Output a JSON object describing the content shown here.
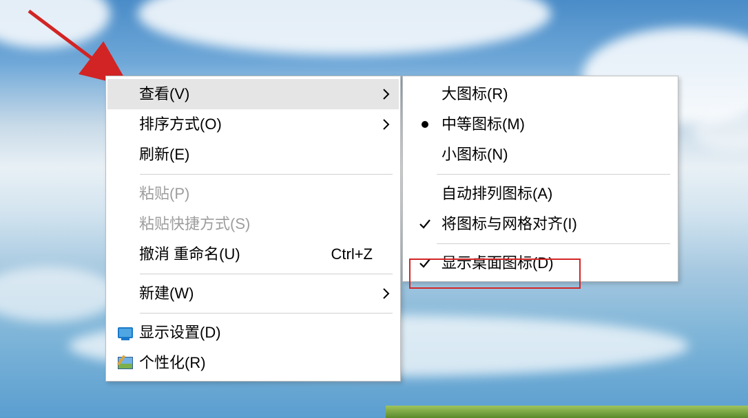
{
  "main_menu": {
    "view": "查看(V)",
    "sort": "排序方式(O)",
    "refresh": "刷新(E)",
    "paste": "粘贴(P)",
    "paste_shortcut": "粘贴快捷方式(S)",
    "undo_rename": "撤消 重命名(U)",
    "undo_accel": "Ctrl+Z",
    "new": "新建(W)",
    "display_settings": "显示设置(D)",
    "personalize": "个性化(R)"
  },
  "sub_menu": {
    "large_icons": "大图标(R)",
    "medium_icons": "中等图标(M)",
    "small_icons": "小图标(N)",
    "auto_arrange": "自动排列图标(A)",
    "align_grid": "将图标与网格对齐(I)",
    "show_desktop_icons": "显示桌面图标(D)"
  }
}
